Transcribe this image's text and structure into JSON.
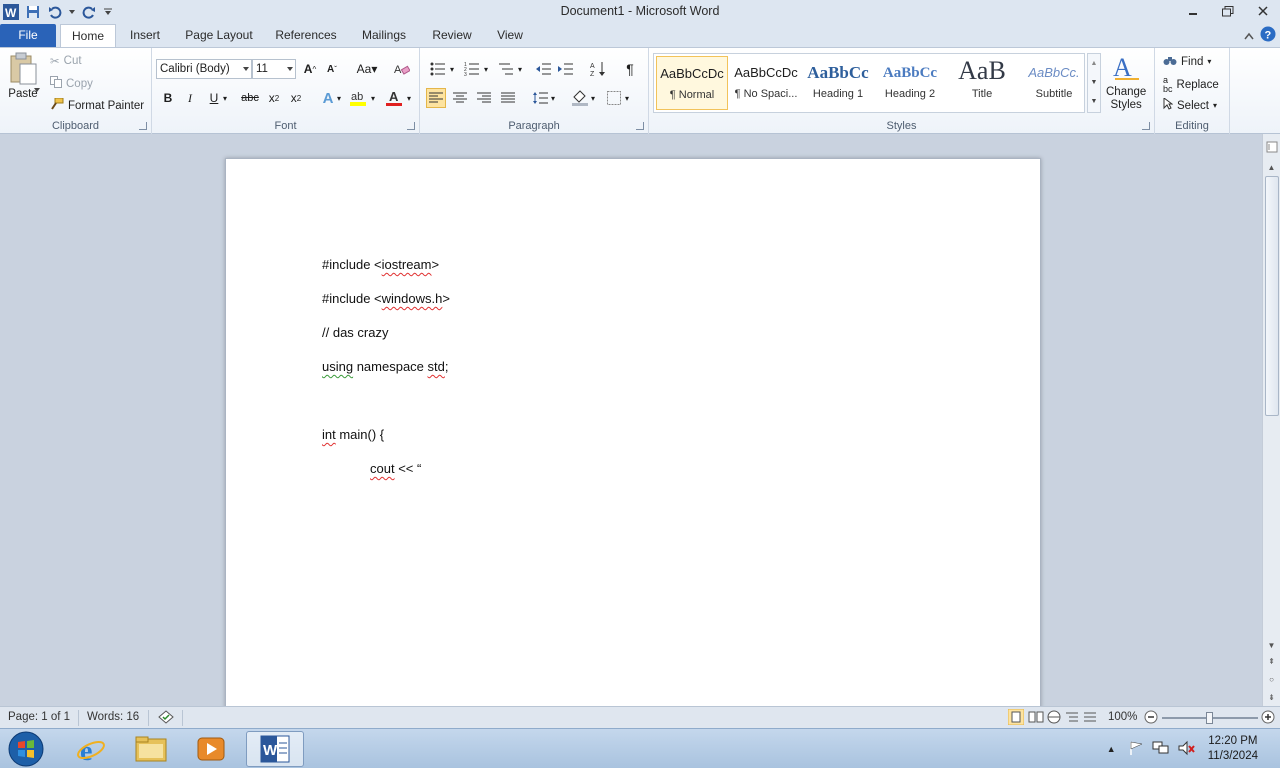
{
  "window": {
    "title": "Document1 - Microsoft Word"
  },
  "tabs": {
    "file": "File",
    "home": "Home",
    "insert": "Insert",
    "page_layout": "Page Layout",
    "references": "References",
    "mailings": "Mailings",
    "review": "Review",
    "view": "View"
  },
  "clipboard": {
    "paste": "Paste",
    "cut": "Cut",
    "copy": "Copy",
    "format_painter": "Format Painter",
    "label": "Clipboard"
  },
  "font": {
    "name": "Calibri (Body)",
    "size": "11",
    "label": "Font"
  },
  "paragraph": {
    "label": "Paragraph"
  },
  "styles": {
    "items": [
      {
        "preview": "AaBbCcDc",
        "name": "¶ Normal"
      },
      {
        "preview": "AaBbCcDc",
        "name": "¶ No Spaci..."
      },
      {
        "preview": "AaBbCc",
        "name": "Heading 1"
      },
      {
        "preview": "AaBbCc",
        "name": "Heading 2"
      },
      {
        "preview": "AaB",
        "name": "Title"
      },
      {
        "preview": "AaBbCc.",
        "name": "Subtitle"
      }
    ],
    "change_styles_1": "Change",
    "change_styles_2": "Styles",
    "label": "Styles"
  },
  "editing": {
    "find": "Find",
    "replace": "Replace",
    "select": "Select",
    "label": "Editing"
  },
  "document": {
    "lines": [
      {
        "pre": "#include <",
        "word": "iostream",
        "post": ">"
      },
      {
        "pre": "#include <",
        "word": "windows.h",
        "post": ">"
      },
      {
        "text": "// das crazy"
      },
      {
        "w1": "using",
        "mid": " namespace ",
        "w2": "std",
        "post": ";"
      },
      {
        "w1": "int",
        "post": " main() {"
      },
      {
        "w1": "cout",
        "post": " << “"
      }
    ]
  },
  "status": {
    "page": "Page: 1 of 1",
    "words": "Words: 16",
    "zoom": "100%"
  },
  "taskbar": {
    "time": "12:20 PM",
    "date": "11/3/2024"
  },
  "colors": {
    "file_tab": "#2a63b8",
    "accent": "#2b579a"
  }
}
